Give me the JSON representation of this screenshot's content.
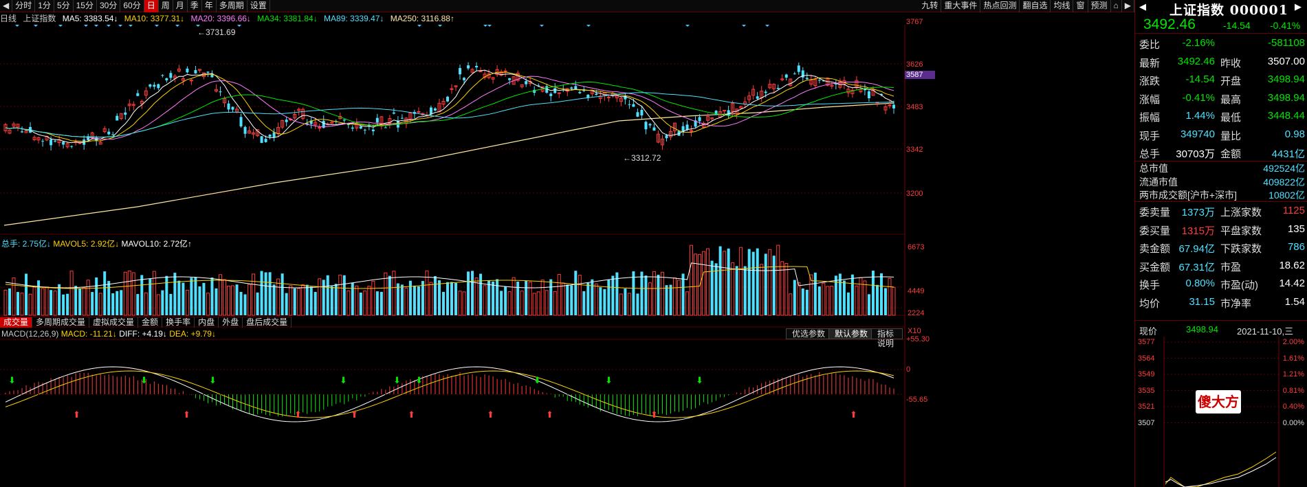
{
  "toolbar": {
    "periods": [
      "分时",
      "1分",
      "5分",
      "15分",
      "30分",
      "60分",
      "日",
      "周",
      "月",
      "季",
      "年",
      "多周期",
      "设置"
    ],
    "active_period": "日",
    "right_buttons": [
      "九转",
      "重大事件",
      "热点回测",
      "翻自选",
      "均线",
      "窗",
      "预测"
    ]
  },
  "indicators_main": {
    "period_label": "日线",
    "index_name": "上证指数",
    "ma5": "MA5: 3383.54↓",
    "ma10": "MA10: 3377.31↓",
    "ma20": "MA20: 3396.66↓",
    "ma34": "MA34: 3381.84↓",
    "ma89": "MA89: 3339.47↓",
    "ma250": "MA250: 3116.88↑"
  },
  "price_axis": [
    "3767",
    "3626",
    "3587",
    "3483",
    "3342",
    "3200"
  ],
  "high_label": "3731.69",
  "low_label": "3312.72",
  "volume_indicators": {
    "total": "总手: 2.75亿↓",
    "mavol5": "MAVOL5: 2.92亿↓",
    "mavol10": "MAVOL10: 2.72亿↑"
  },
  "volume_axis": [
    "6673",
    "4449",
    "2224",
    "X10"
  ],
  "sub_tabs": [
    "成交量",
    "多周期成交量",
    "虚拟成交量",
    "金额",
    "换手率",
    "内盘",
    "外盘",
    "盘后成交量"
  ],
  "active_sub_tab": "成交量",
  "macd": {
    "label": "MACD(12,26,9)",
    "macd": "MACD: -11.21↓",
    "diff": "DIFF: +4.19↓",
    "dea": "DEA: +9.79↓",
    "axis": [
      "+55.30",
      "0",
      "-55.65"
    ],
    "buttons": [
      "优选参数",
      "默认参数",
      "指标说明"
    ]
  },
  "panel": {
    "title": "上证指数 000001",
    "price": "3492.46",
    "change": "-14.54",
    "change_pct": "-0.41%",
    "rows": [
      {
        "k": "委比",
        "v": "-2.16%",
        "v_color": "green",
        "k2": "",
        "v2": "-581108",
        "v2_color": "green"
      },
      {
        "k": "最新",
        "v": "3492.46",
        "v_color": "green",
        "k2": "昨收",
        "v2": "3507.00",
        "v2_color": "white"
      },
      {
        "k": "涨跌",
        "v": "-14.54",
        "v_color": "green",
        "k2": "开盘",
        "v2": "3498.94",
        "v2_color": "green"
      },
      {
        "k": "涨幅",
        "v": "-0.41%",
        "v_color": "green",
        "k2": "最高",
        "v2": "3498.94",
        "v2_color": "green"
      },
      {
        "k": "振幅",
        "v": "1.44%",
        "v_color": "cyan",
        "k2": "最低",
        "v2": "3448.44",
        "v2_color": "green"
      },
      {
        "k": "现手",
        "v": "349740",
        "v_color": "cyan",
        "k2": "量比",
        "v2": "0.98",
        "v2_color": "cyan"
      },
      {
        "k": "总手",
        "v": "30703万",
        "v_color": "white",
        "k2": "金额",
        "v2": "4431亿",
        "v2_color": "cyan"
      }
    ],
    "rows_wide": [
      {
        "k": "总市值",
        "v": "492524亿"
      },
      {
        "k": "流通市值",
        "v": "409822亿"
      },
      {
        "k": "两市成交额[沪市+深市]",
        "v": "10802亿"
      }
    ],
    "rows2": [
      {
        "k": "委卖量",
        "v": "1373万",
        "v_color": "cyan",
        "k2": "上涨家数",
        "v2": "1125",
        "v2_color": "red"
      },
      {
        "k": "委买量",
        "v": "1315万",
        "v_color": "red",
        "k2": "平盘家数",
        "v2": "135",
        "v2_color": "white"
      },
      {
        "k": "卖金额",
        "v": "67.94亿",
        "v_color": "cyan",
        "k2": "下跌家数",
        "v2": "786",
        "v2_color": "cyan"
      },
      {
        "k": "买金额",
        "v": "67.31亿",
        "v_color": "cyan",
        "k2": "市盈",
        "v2": "18.62",
        "v2_color": "white"
      },
      {
        "k": "换手",
        "v": "0.80%",
        "v_color": "cyan",
        "k2": "市盈(动)",
        "v2": "14.42",
        "v2_color": "white"
      },
      {
        "k": "均价",
        "v": "31.15",
        "v_color": "cyan",
        "k2": "市净率",
        "v2": "1.54",
        "v2_color": "white"
      }
    ],
    "current_label": "现价",
    "current_value": "3498.94",
    "date": "2021-11-10,三",
    "mini_left_axis": [
      "3577",
      "3564",
      "3549",
      "3535",
      "3521",
      "3507"
    ],
    "mini_right_axis": [
      "2.00%",
      "1.61%",
      "1.21%",
      "0.81%",
      "0.40%",
      "0.00%"
    ],
    "watermark": "傻大方"
  }
}
